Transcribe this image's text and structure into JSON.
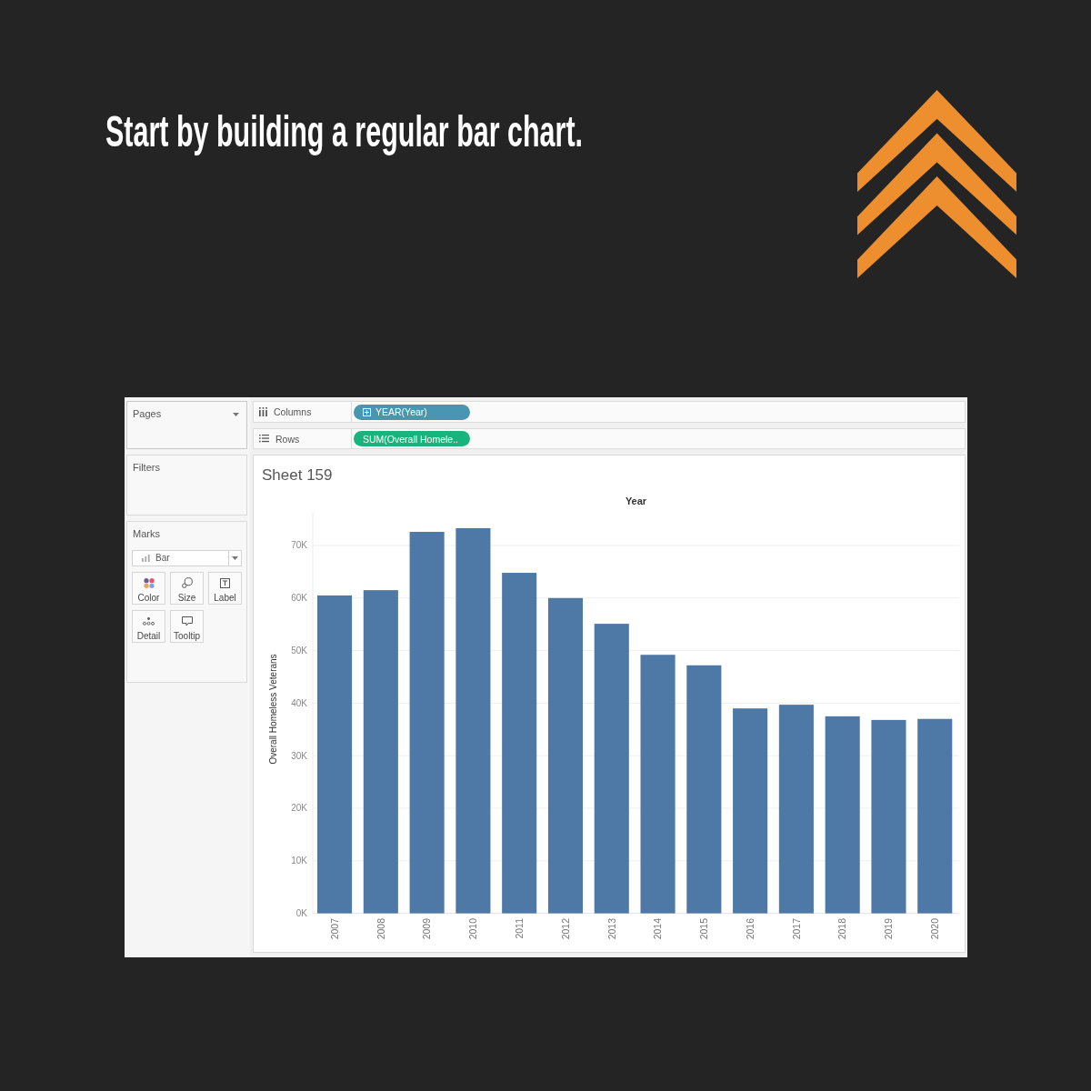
{
  "headline": "Start by building a regular bar chart.",
  "workbook": {
    "pages": {
      "title": "Pages"
    },
    "filters": {
      "title": "Filters"
    },
    "marks": {
      "title": "Marks",
      "mark_type": "Bar",
      "buttons": [
        {
          "kind": "color",
          "label": "Color"
        },
        {
          "kind": "size",
          "label": "Size"
        },
        {
          "kind": "label",
          "label": "Label"
        },
        {
          "kind": "detail",
          "label": "Detail"
        },
        {
          "kind": "tooltip",
          "label": "Tooltip"
        }
      ]
    },
    "shelves": [
      {
        "kind": "columns",
        "label": "Columns",
        "pill": {
          "text": "YEAR(Year)",
          "color": "#4996b2",
          "drillable": true
        }
      },
      {
        "kind": "rows",
        "label": "Rows",
        "pill": {
          "text": "SUM(Overall Homele..",
          "color": "#1bb37d",
          "drillable": false
        }
      }
    ],
    "sheet": {
      "title": "Sheet 159",
      "chart_data": {
        "type": "bar",
        "xlabel": "Year",
        "ylabel": "Overall Homeless Veterans",
        "categories": [
          "2007",
          "2008",
          "2009",
          "2010",
          "2011",
          "2012",
          "2013",
          "2014",
          "2015",
          "2016",
          "2017",
          "2018",
          "2019",
          "2020"
        ],
        "values": [
          60500,
          61500,
          72600,
          73300,
          64800,
          60000,
          55100,
          49200,
          47200,
          39000,
          39700,
          37500,
          36800,
          37000
        ],
        "ylim": [
          0,
          76400
        ],
        "yticks": [
          {
            "value": 0,
            "label": "0K"
          },
          {
            "value": 10000,
            "label": "10K"
          },
          {
            "value": 20000,
            "label": "20K"
          },
          {
            "value": 30000,
            "label": "30K"
          },
          {
            "value": 40000,
            "label": "40K"
          },
          {
            "value": 50000,
            "label": "50K"
          },
          {
            "value": 60000,
            "label": "60K"
          },
          {
            "value": 70000,
            "label": "70K"
          }
        ],
        "grid": true
      }
    }
  }
}
